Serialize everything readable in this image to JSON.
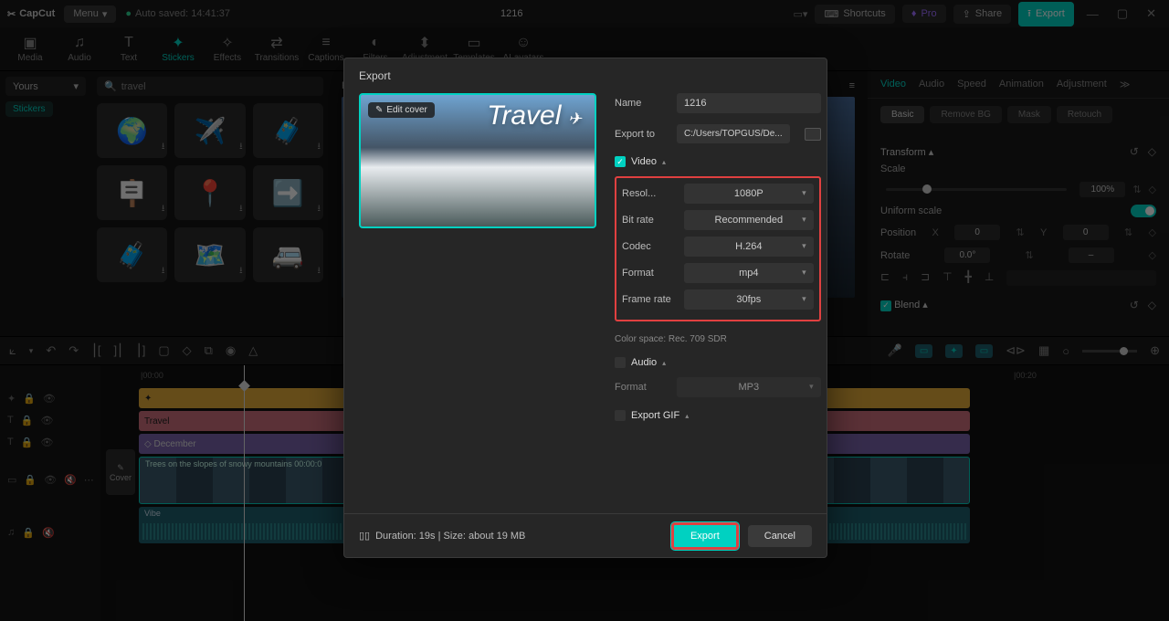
{
  "titlebar": {
    "app": "CapCut",
    "menu": "Menu",
    "saved": "Auto saved: 14:41:37",
    "project": "1216",
    "shortcuts": "Shortcuts",
    "pro": "Pro",
    "share": "Share",
    "export": "Export"
  },
  "tools": [
    "Media",
    "Audio",
    "Text",
    "Stickers",
    "Effects",
    "Transitions",
    "Captions",
    "Filters",
    "Adjustment",
    "Templates",
    "AI avatars"
  ],
  "tool_icons": [
    "▣",
    "♫",
    "T",
    "✦",
    "✧",
    "⇄",
    "≡",
    "◐",
    "⬍",
    "▭",
    "☺"
  ],
  "left": {
    "yours": "Yours",
    "stickers": "Stickers"
  },
  "search": {
    "placeholder": "travel"
  },
  "stickers": [
    "🌍",
    "✈️",
    "🧳",
    "🪧",
    "📍",
    "➡️",
    "🧳",
    "🗺️",
    "🚐"
  ],
  "player": {
    "label": "Player"
  },
  "rp": {
    "tabs": [
      "Video",
      "Audio",
      "Speed",
      "Animation",
      "Adjustment"
    ],
    "sub": [
      "Basic",
      "Remove BG",
      "Mask",
      "Retouch"
    ],
    "transform": "Transform",
    "scale": "Scale",
    "scale_val": "100%",
    "uniform": "Uniform scale",
    "position": "Position",
    "x": "X",
    "xv": "0",
    "y": "Y",
    "yv": "0",
    "rotate": "Rotate",
    "rv": "0.0°",
    "blend": "Blend"
  },
  "timeline": {
    "t0": "|00:00",
    "t1": "|00:20",
    "tracks": {
      "a": "✦",
      "b": "Travel",
      "c": "◇ December",
      "v": "Trees on the slopes of snowy mountains   00:00:0",
      "au": "Vibe"
    },
    "cover": "Cover"
  },
  "modal": {
    "title": "Export",
    "edit": "Edit cover",
    "cover_title": "Travel",
    "name_l": "Name",
    "name_v": "1216",
    "path_l": "Export to",
    "path_v": "C:/Users/TOPGUS/De...",
    "video": "Video",
    "rows": {
      "res_l": "Resol...",
      "res_v": "1080P",
      "bit_l": "Bit rate",
      "bit_v": "Recommended",
      "cod_l": "Codec",
      "cod_v": "H.264",
      "fmt_l": "Format",
      "fmt_v": "mp4",
      "fr_l": "Frame rate",
      "fr_v": "30fps"
    },
    "cs": "Color space: Rec. 709 SDR",
    "audio": "Audio",
    "afmt_l": "Format",
    "afmt_v": "MP3",
    "gif": "Export GIF",
    "dur": "Duration: 19s | Size: about 19 MB",
    "export": "Export",
    "cancel": "Cancel"
  }
}
